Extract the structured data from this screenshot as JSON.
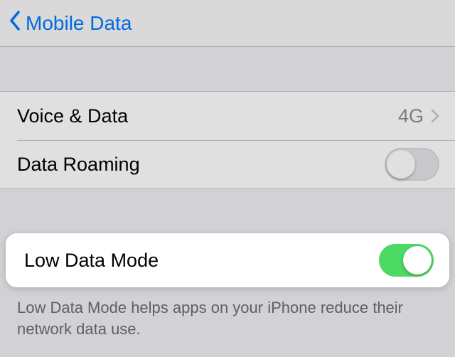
{
  "nav": {
    "back_label": "Mobile Data"
  },
  "group1": {
    "voice_data": {
      "label": "Voice & Data",
      "value": "4G"
    },
    "data_roaming": {
      "label": "Data Roaming",
      "enabled": false
    }
  },
  "group2": {
    "low_data_mode": {
      "label": "Low Data Mode",
      "enabled": true
    }
  },
  "footer": {
    "low_data_mode_help": "Low Data Mode helps apps on your iPhone reduce their network data use."
  },
  "colors": {
    "tint": "#007aff",
    "switch_on": "#4cd964",
    "bg": "#efeff4"
  }
}
